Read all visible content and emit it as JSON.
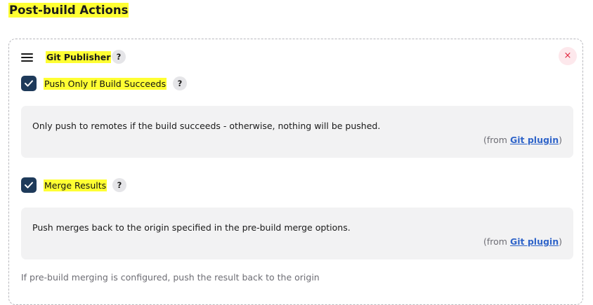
{
  "section": {
    "title": "Post-build Actions"
  },
  "publisher": {
    "title": "Git Publisher",
    "help_label": "?",
    "close_label": "×"
  },
  "options": [
    {
      "label": "Push Only If Build Succeeds",
      "checked": true,
      "help_label": "?",
      "description": "Only push to remotes if the build succeeds - otherwise, nothing will be pushed.",
      "from_prefix": "(from ",
      "plugin_link": "Git plugin",
      "from_suffix": ")"
    },
    {
      "label": "Merge Results",
      "checked": true,
      "help_label": "?",
      "description": "Push merges back to the origin specified in the pre-build merge options.",
      "from_prefix": "(from ",
      "plugin_link": "Git plugin",
      "from_suffix": ")"
    }
  ],
  "footer_description": "If pre-build merging is configured, push the result back to the origin",
  "colors": {
    "highlight": "#ffff33",
    "checkbox": "#1e3a5a",
    "link": "#2f64c9",
    "close": "#e0263e"
  }
}
